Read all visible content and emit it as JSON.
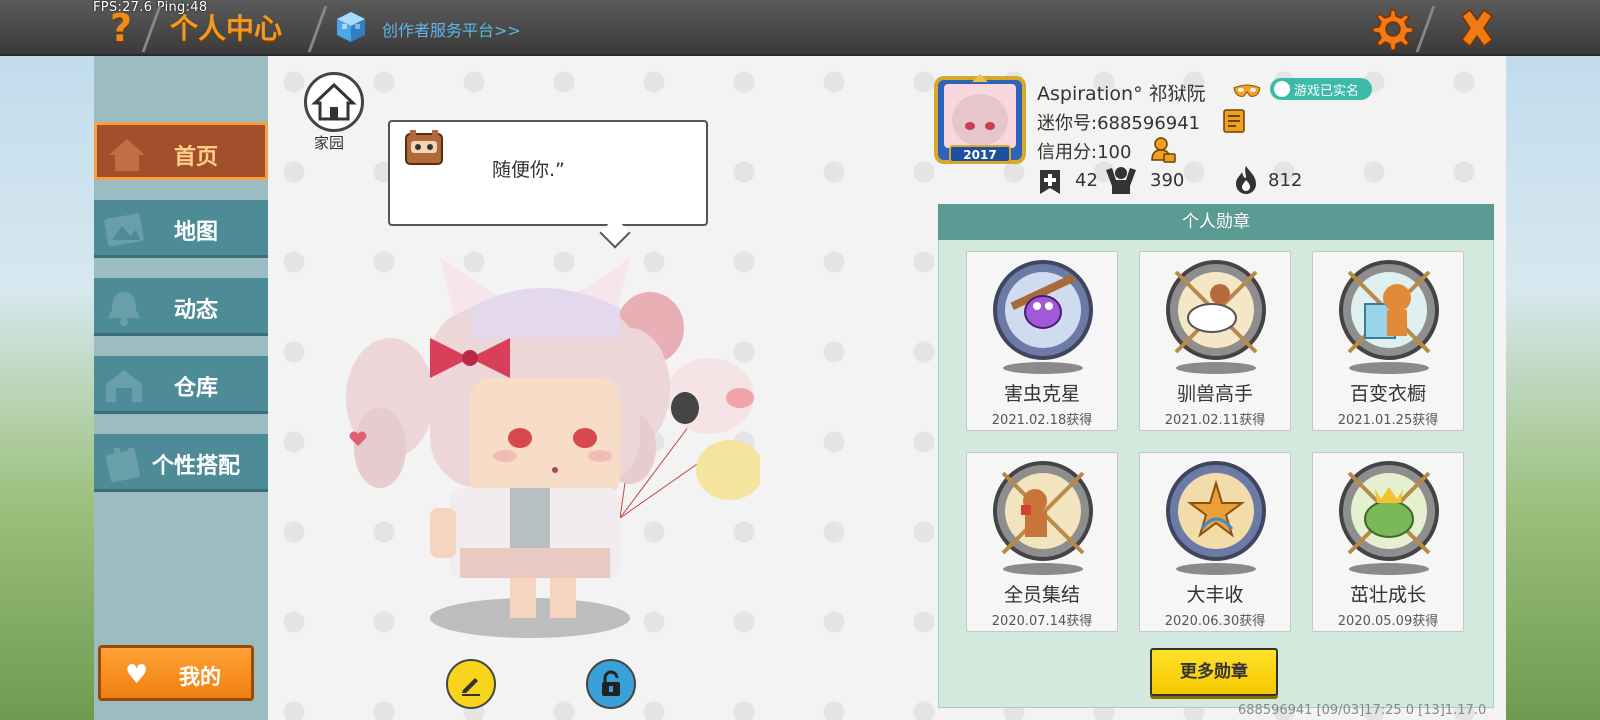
{
  "status": {
    "fps_ping": "FPS:27.6  Ping:48"
  },
  "header": {
    "title": "个人中心",
    "creator_link": "创作者服务平台>>",
    "icons": [
      "help-icon",
      "cube-icon",
      "gear-icon",
      "close-icon"
    ],
    "accent_color": "#f29a21"
  },
  "sidebar": {
    "items": [
      {
        "label": "首页",
        "icon": "house-icon",
        "active": true
      },
      {
        "label": "地图",
        "icon": "map-icon",
        "active": false
      },
      {
        "label": "动态",
        "icon": "bell-icon",
        "active": false
      },
      {
        "label": "仓库",
        "icon": "warehouse-icon",
        "active": false
      },
      {
        "label": "个性搭配",
        "icon": "outfit-icon",
        "active": false
      }
    ],
    "my_button": "我的"
  },
  "home": {
    "home_label": "家园",
    "bubble_text": "随便你.”"
  },
  "profile": {
    "username": "Aspiration° 祁狱阮",
    "realname_badge": "游戏已实名",
    "mini_id": "迷你号:688596941",
    "credit": "信用分:100",
    "avatar_year": "2017",
    "stats": {
      "bookmarks": "42",
      "fans": "390",
      "heat": "812"
    }
  },
  "medals": {
    "header": "个人勋章",
    "items": [
      {
        "name": "害虫克星",
        "date": "2021.02.18获得"
      },
      {
        "name": "驯兽高手",
        "date": "2021.02.11获得"
      },
      {
        "name": "百变衣橱",
        "date": "2021.01.25获得"
      },
      {
        "name": "全员集结",
        "date": "2020.07.14获得"
      },
      {
        "name": "大丰收",
        "date": "2020.06.30获得"
      },
      {
        "name": "茁壮成长",
        "date": "2020.05.09获得"
      }
    ],
    "more_button": "更多勋章"
  },
  "footer": {
    "info": "688596941   [09/03]17:25 0   [13]1.17.0"
  }
}
